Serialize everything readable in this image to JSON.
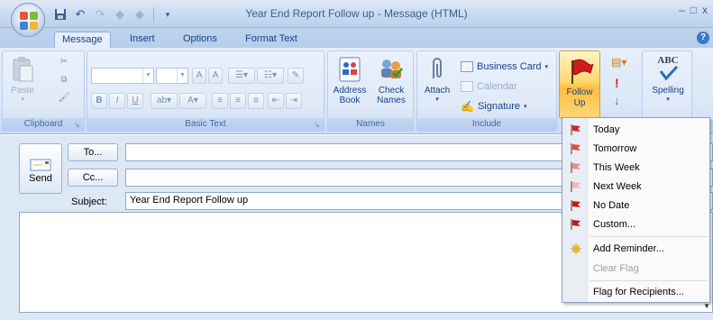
{
  "window": {
    "title": "Year End Report Follow up - Message (HTML)",
    "controls": [
      "–",
      "□",
      "x"
    ]
  },
  "tabs": [
    {
      "label": "Message",
      "active": true
    },
    {
      "label": "Insert",
      "active": false
    },
    {
      "label": "Options",
      "active": false
    },
    {
      "label": "Format Text",
      "active": false
    }
  ],
  "ribbon": {
    "clipboard": {
      "label": "Clipboard",
      "paste_label": "Paste"
    },
    "basic_text": {
      "label": "Basic Text"
    },
    "names": {
      "label": "Names",
      "address_book_line1": "Address",
      "address_book_line2": "Book",
      "check_names_line1": "Check",
      "check_names_line2": "Names"
    },
    "include": {
      "label": "Include",
      "attach_label": "Attach",
      "business_card_label": "Business Card",
      "calendar_label": "Calendar",
      "signature_label": "Signature"
    },
    "follow_up": {
      "line1": "Follow",
      "line2": "Up"
    },
    "proofing": {
      "spelling_label": "Spelling",
      "abc_label": "ABC"
    }
  },
  "compose": {
    "send_label": "Send",
    "to_label": "To...",
    "cc_label": "Cc...",
    "subject_label": "Subject:",
    "to_value": "",
    "cc_value": "",
    "subject_value": "Year End Report Follow up"
  },
  "follow_up_menu": {
    "items": [
      {
        "label": "Today",
        "flag_color": "#d62020",
        "disabled": false
      },
      {
        "label": "Tomorrow",
        "flag_color": "#e24848",
        "disabled": false
      },
      {
        "label": "This Week",
        "flag_color": "#ee8a8a",
        "disabled": false
      },
      {
        "label": "Next Week",
        "flag_color": "#f4b4b4",
        "disabled": false
      },
      {
        "label": "No Date",
        "flag_color": "#c81414",
        "disabled": false
      },
      {
        "label": "Custom...",
        "flag_color": "#c81414",
        "disabled": false
      },
      {
        "label": "Add Reminder...",
        "flag_color": "",
        "disabled": false
      },
      {
        "label": "Clear Flag",
        "flag_color": "",
        "disabled": true
      },
      {
        "label": "Flag for Recipients...",
        "flag_color": "",
        "disabled": false
      }
    ]
  },
  "colors": {
    "ribbon_bg": "#dbe7f6",
    "accent_text": "#15428b",
    "followup_highlight": "#ffbd3d"
  }
}
